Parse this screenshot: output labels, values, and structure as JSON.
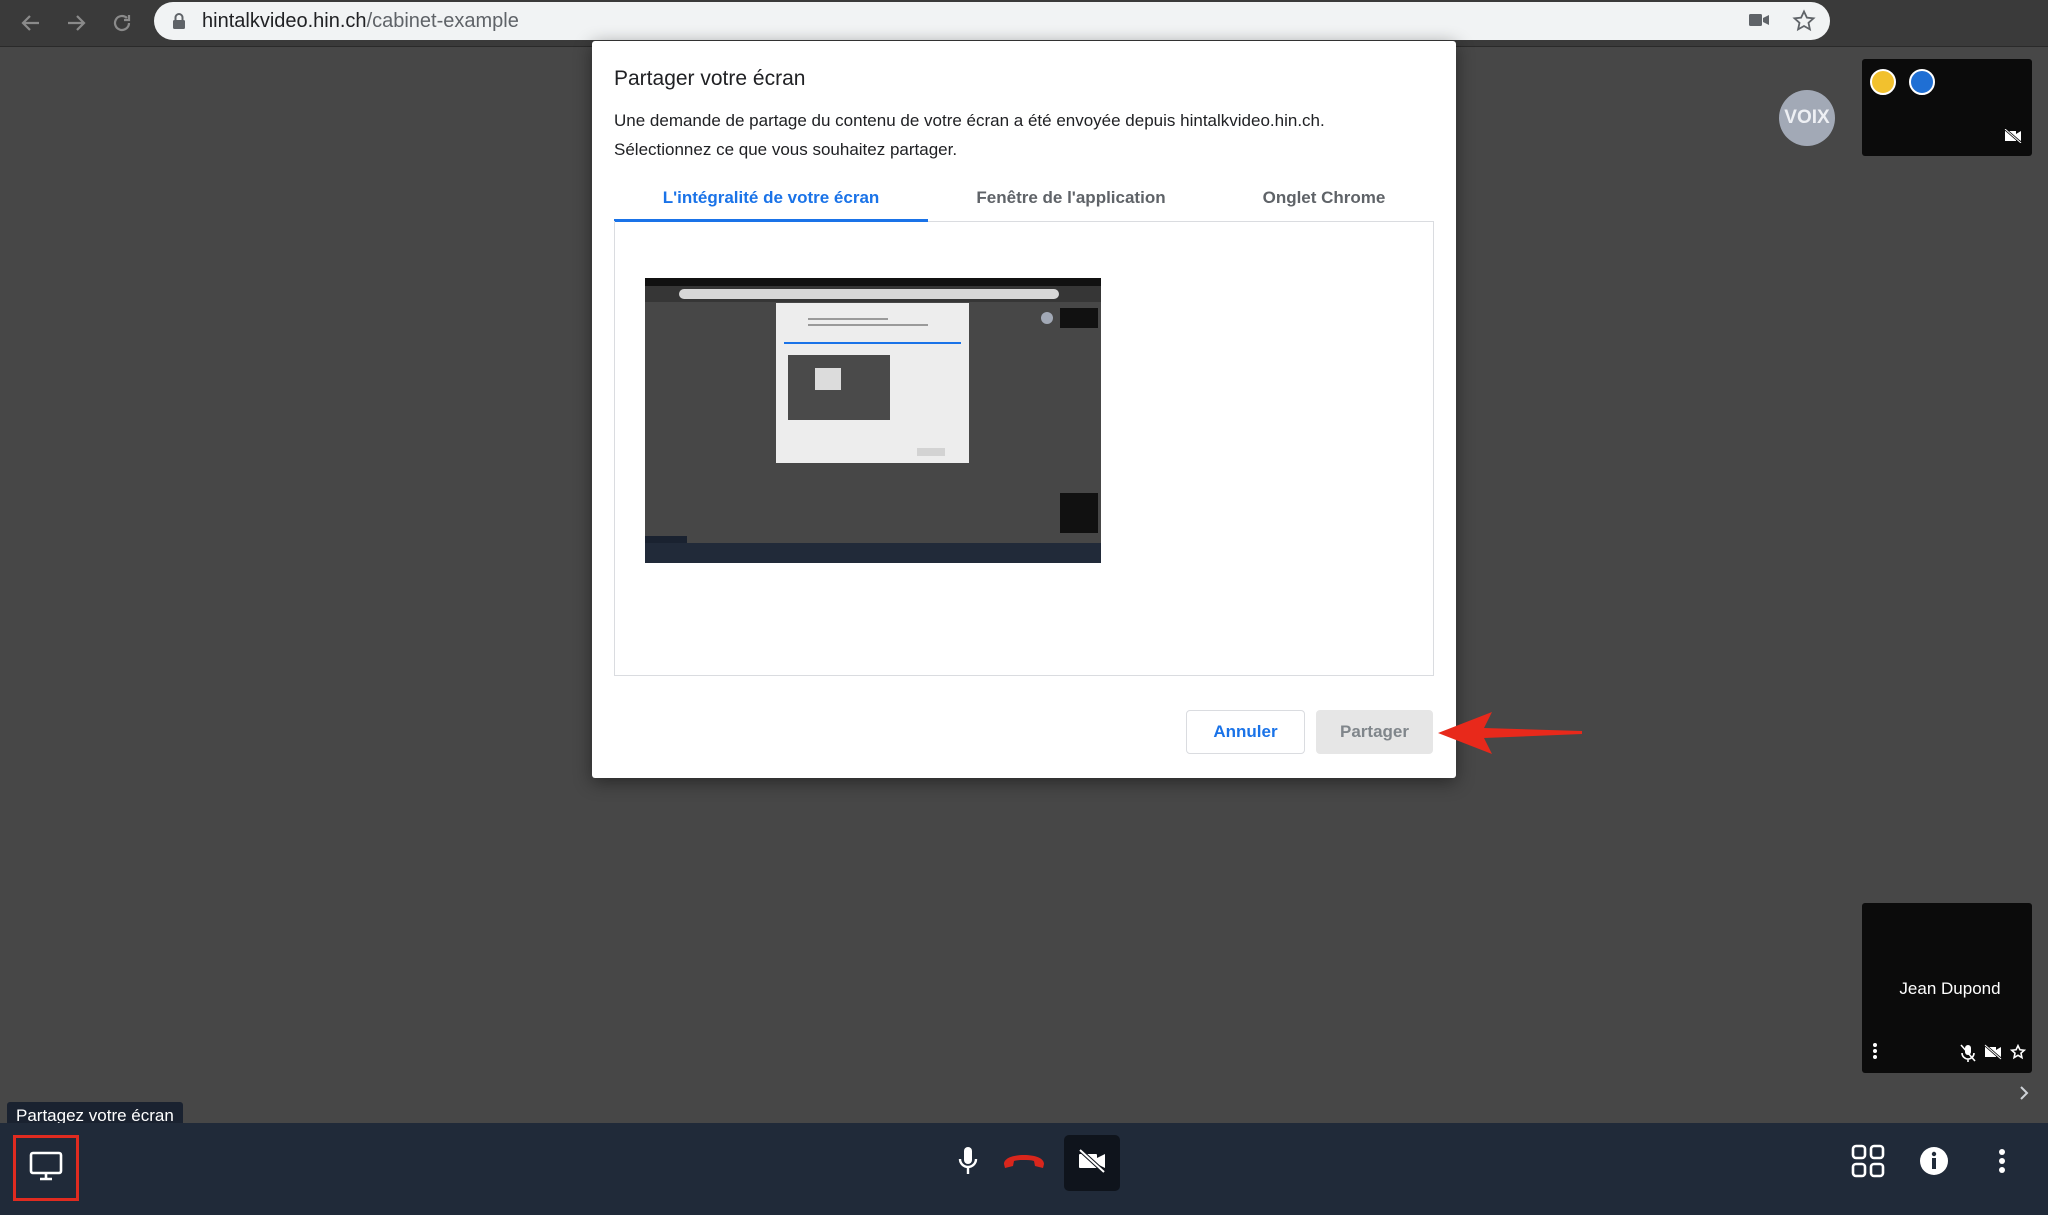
{
  "browser": {
    "url_host": "hintalkvideo.hin.ch",
    "url_path": "/cabinet-example",
    "icons": [
      "back-icon",
      "forward-icon",
      "reload-icon",
      "lock-icon",
      "camera-icon",
      "bookmark-star-icon"
    ]
  },
  "dialog": {
    "title": "Partager votre écran",
    "description_line1": "Une demande de partage du contenu de votre écran a été envoyée depuis hintalkvideo.hin.ch.",
    "description_line2": "Sélectionnez ce que vous souhaitez partager.",
    "tabs": [
      {
        "label": "L'intégralité de votre écran",
        "active": true
      },
      {
        "label": "Fenêtre de l'application",
        "active": false
      },
      {
        "label": "Onglet Chrome",
        "active": false
      }
    ],
    "cancel_label": "Annuler",
    "share_label": "Partager"
  },
  "conference": {
    "voix_label": "VOIX",
    "participant_name": "Jean Dupond",
    "indicator_colors": [
      "#f2c12e",
      "#1f6fd4"
    ]
  },
  "toolbar": {
    "tooltip": "Partagez votre écran",
    "hangup_color": "#d9261c"
  },
  "colors": {
    "accent": "#1a73e8",
    "highlight": "#e02b20"
  }
}
